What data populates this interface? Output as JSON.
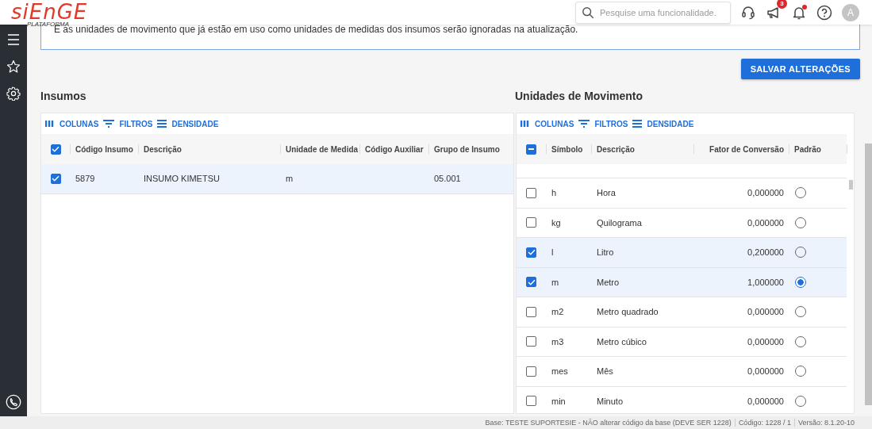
{
  "header": {
    "logo": "siEnGE",
    "logo_sub": "PLATAFORMA",
    "search": {
      "placeholder": "Pesquise uma funcionalidade."
    },
    "announcements_badge": "3",
    "notifications_dot": true,
    "avatar": "A"
  },
  "info_text": "E as unidades de movimento que já estão em uso como unidades de medidas dos insumos serão ignoradas na atualização.",
  "save_button": "SALVAR ALTERAÇÕES",
  "panels": [
    {
      "title": "Insumos",
      "toolbar": [
        "COLUNAS",
        "FILTROS",
        "DENSIDADE"
      ],
      "header_checkbox": {
        "checked": true
      },
      "columns": [
        {
          "label": "Código Insumo",
          "kind": "text"
        },
        {
          "label": "Descrição",
          "kind": "text"
        },
        {
          "label": "Unidade de Medida",
          "kind": "text"
        },
        {
          "label": "Código Auxiliar",
          "kind": "text"
        },
        {
          "label": "Grupo de Insumo",
          "kind": "text"
        }
      ],
      "rows": [
        {
          "selected": true,
          "cells": [
            "5879",
            "INSUMO KIMETSU",
            "m",
            "",
            "05.001"
          ]
        }
      ]
    },
    {
      "title": "Unidades de Movimento",
      "toolbar": [
        "COLUNAS",
        "FILTROS",
        "DENSIDADE"
      ],
      "header_checkbox": {
        "checked": true,
        "indeterminate": true
      },
      "columns": [
        {
          "label": "Símbolo",
          "kind": "text"
        },
        {
          "label": "Descrição",
          "kind": "text"
        },
        {
          "label": "Fator de Conversão",
          "kind": "number"
        },
        {
          "label": "Padrão",
          "kind": "radio"
        }
      ],
      "rows": [
        {
          "selected": false,
          "cells": [
            "h",
            "Hora",
            "0,000000"
          ],
          "default": false
        },
        {
          "selected": false,
          "cells": [
            "kg",
            "Quilograma",
            "0,000000"
          ],
          "default": false
        },
        {
          "selected": true,
          "cells": [
            "l",
            "Litro",
            "0,200000"
          ],
          "default": false
        },
        {
          "selected": true,
          "cells": [
            "m",
            "Metro",
            "1,000000"
          ],
          "default": true
        },
        {
          "selected": false,
          "cells": [
            "m2",
            "Metro quadrado",
            "0,000000"
          ],
          "default": false
        },
        {
          "selected": false,
          "cells": [
            "m3",
            "Metro cúbico",
            "0,000000"
          ],
          "default": false
        },
        {
          "selected": false,
          "cells": [
            "mes",
            "Mês",
            "0,000000"
          ],
          "default": false
        },
        {
          "selected": false,
          "cells": [
            "min",
            "Minuto",
            "0,000000"
          ],
          "default": false
        }
      ]
    }
  ],
  "status_bar": [
    "Base: TESTE SUPORTESIE - NÃO alterar código da base (DEVE SER 1228)",
    "Código: 1228 / 1",
    "Versão: 8.1.20-10"
  ]
}
